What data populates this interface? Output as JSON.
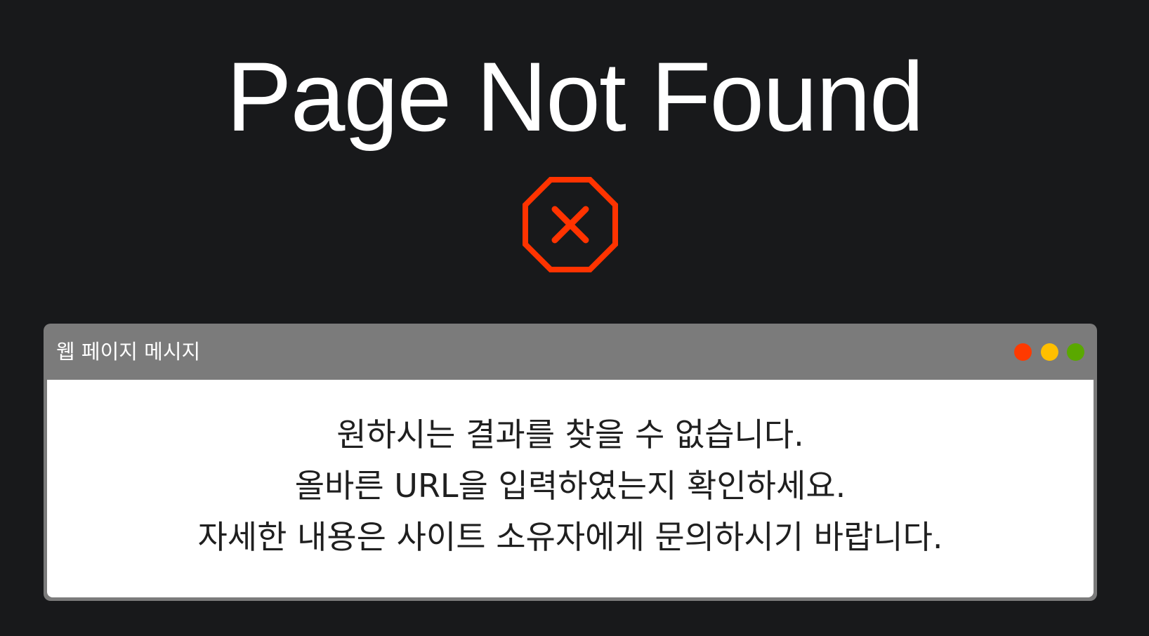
{
  "page": {
    "title": "Page Not Found"
  },
  "icon": {
    "name": "stop-x-icon",
    "color": "#ff3300"
  },
  "dialog": {
    "title": "웹 페이지 메시지",
    "window_controls": [
      {
        "name": "close",
        "color": "#ff3a00"
      },
      {
        "name": "minimize",
        "color": "#ffbf00"
      },
      {
        "name": "maximize",
        "color": "#5aa800"
      }
    ],
    "message_lines": [
      "원하시는 결과를 찾을 수 없습니다.",
      "올바른 URL을 입력하였는지 확인하세요.",
      "자세한 내용은 사이트 소유자에게 문의하시기 바랍니다."
    ]
  },
  "colors": {
    "background": "#18191b",
    "dialog_frame": "#7b7b7b",
    "dialog_body": "#ffffff"
  }
}
